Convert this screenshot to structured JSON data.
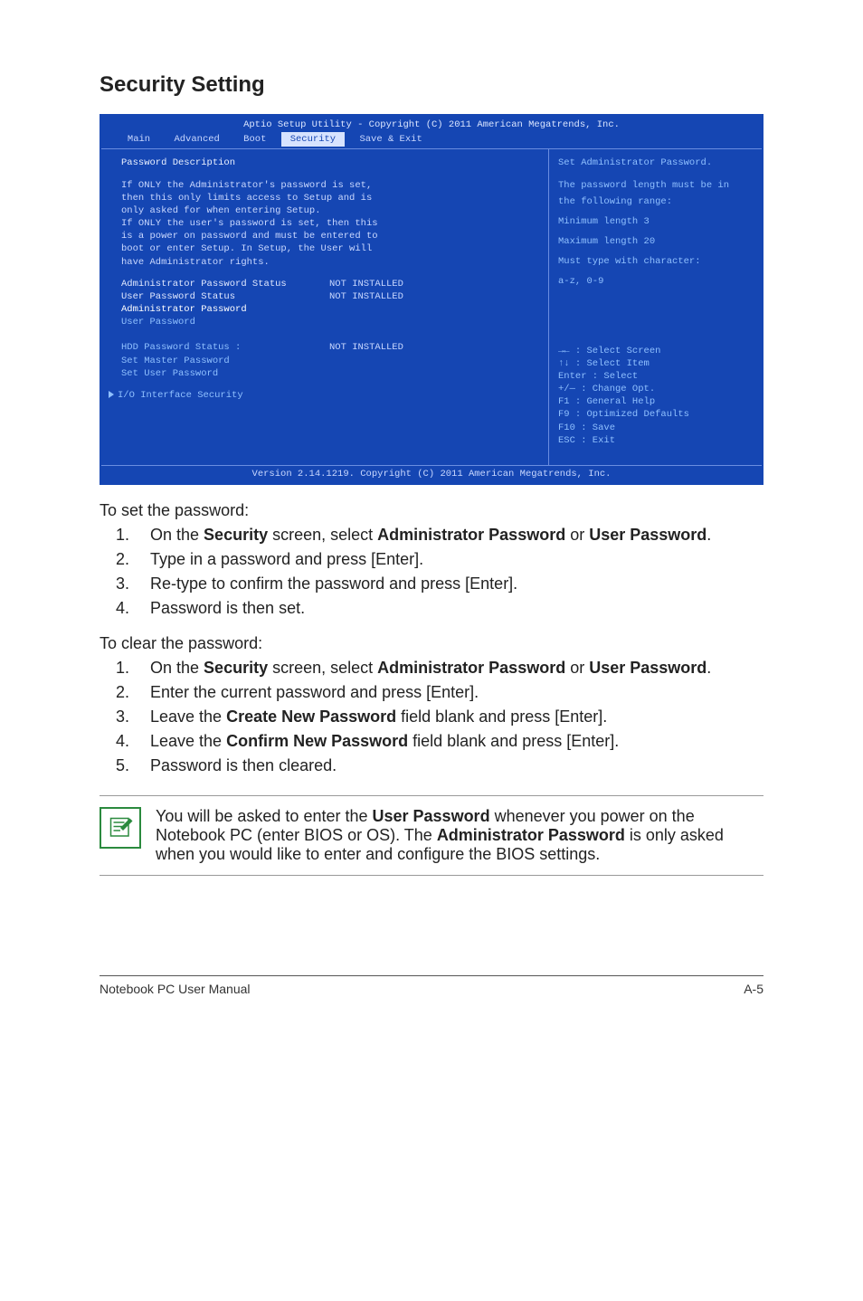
{
  "heading": "Security Setting",
  "bios": {
    "title": "Aptio Setup Utility - Copyright (C) 2011 American Megatrends, Inc.",
    "tabs": [
      "Main",
      "Advanced",
      "Boot",
      "Security",
      "Save & Exit"
    ],
    "active_tab": "Security",
    "left": {
      "hdr": "Password Description",
      "desc": [
        "If ONLY the Administrator's password is set,",
        "then this only limits access to Setup and is",
        "only asked for when entering Setup.",
        "If ONLY the user's password is set, then this",
        "is a power on password and must be entered to",
        "boot or enter Setup. In Setup, the User will",
        "have Administrator rights."
      ],
      "kv1_k": "Administrator Password Status",
      "kv1_v": "NOT INSTALLED",
      "kv2_k": "User Password Status",
      "kv2_v": "NOT INSTALLED",
      "admin_pw": "Administrator Password",
      "user_pw": "User Password",
      "hdd_k": "HDD Password Status :",
      "hdd_v": "NOT INSTALLED",
      "set_master": "Set Master Password",
      "set_user": "Set User Password",
      "io": "I/O Interface Security"
    },
    "right": {
      "l1": "Set Administrator Password.",
      "l2": "The password length must be in",
      "l3": "the following range:",
      "l4": "Minimum length 3",
      "l5": "Maximum length 20",
      "l6": "Must type with character:",
      "l7": "a-z, 0-9",
      "h1": "→←  : Select Screen",
      "h2": "↑↓     : Select Item",
      "h3": "Enter : Select",
      "h4": "+/—   : Change Opt.",
      "h5": "F1      : General Help",
      "h6": "F9      : Optimized Defaults",
      "h7": "F10   : Save",
      "h8": "ESC   : Exit"
    },
    "footer": "Version 2.14.1219. Copyright (C) 2011 American Megatrends, Inc."
  },
  "set_lead": "To set the password:",
  "set_steps": {
    "s1a": "On the ",
    "s1b": "Security",
    "s1c": " screen, select ",
    "s1d": "Administrator Password",
    "s1e": " or ",
    "s1f": "User Password",
    "s1g": ".",
    "s2": "Type in a password and press [Enter].",
    "s3": "Re-type to confirm the password and press [Enter].",
    "s4": "Password is then set."
  },
  "clear_lead": "To clear the password:",
  "clear_steps": {
    "c1a": "On the ",
    "c1b": "Security",
    "c1c": " screen, select ",
    "c1d": "Administrator Password",
    "c1e": " or ",
    "c1f": "User Password",
    "c1g": ".",
    "c2": "Enter the current password and press [Enter].",
    "c3a": "Leave the ",
    "c3b": "Create New Password",
    "c3c": " field blank and press [Enter].",
    "c4a": "Leave the ",
    "c4b": "Confirm New Password",
    "c4c": " field blank and press [Enter].",
    "c5": "Password is then cleared."
  },
  "note": {
    "n1": "You will be asked to enter the ",
    "n2": "User Password",
    "n3": " whenever you power on the Notebook PC (enter BIOS or OS). The ",
    "n4": "Administrator Password",
    "n5": " is only asked when you would like to enter and configure the BIOS settings."
  },
  "footer_left": "Notebook PC User Manual",
  "footer_right": "A-5"
}
